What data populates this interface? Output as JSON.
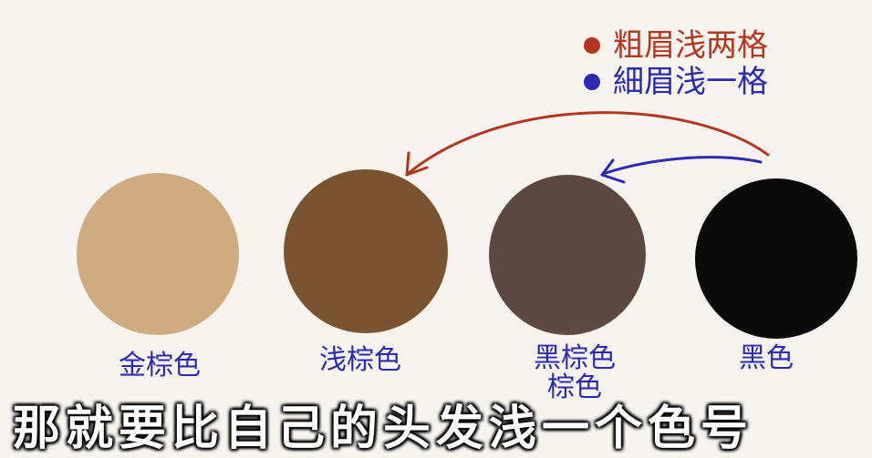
{
  "legend": {
    "items": [
      {
        "text": "粗眉浅两格",
        "color": "#b5361e"
      },
      {
        "text": "細眉浅一格",
        "color": "#2c2ab0"
      }
    ]
  },
  "swatches": [
    {
      "label": "金棕色",
      "sub_label": "",
      "color": "#cfac80"
    },
    {
      "label": "浅棕色",
      "sub_label": "",
      "color": "#7a5430"
    },
    {
      "label": "黑棕色",
      "sub_label": "棕色",
      "color": "#5b4840"
    },
    {
      "label": "黑色",
      "sub_label": "",
      "color": "#0a0a0a"
    }
  ],
  "arrows": [
    {
      "color": "#b5361e",
      "from": "黑色",
      "to": "浅棕色"
    },
    {
      "color": "#2c2ab0",
      "from": "黑色",
      "to": "黑棕色"
    }
  ],
  "caption": {
    "text": "那就要比自己的头发浅一个色号"
  }
}
